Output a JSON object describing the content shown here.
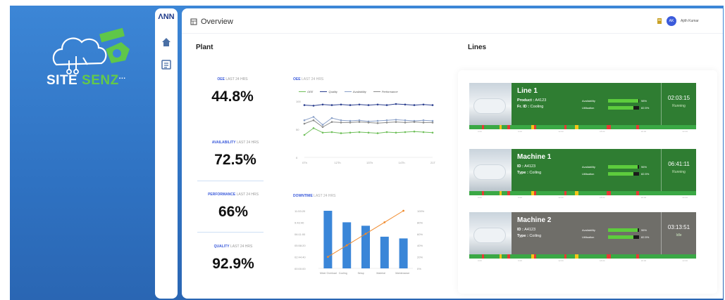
{
  "brand": {
    "name_part1": "SITE ",
    "name_part2": "SENZ",
    "name_suffix": "..."
  },
  "rail": {
    "logo": "ΛNN"
  },
  "header": {
    "title": "Overview",
    "user_initials": "AK",
    "user_name": "Ajith Kumar"
  },
  "plant": {
    "title": "Plant"
  },
  "lines_title": "Lines",
  "kpis": [
    {
      "name": "OEE",
      "period": "LAST 24 HRS",
      "value": "44.8%"
    },
    {
      "name": "AVAILABILITY",
      "period": "LAST 24 HRS",
      "value": "72.5%"
    },
    {
      "name": "PERFORMANCE",
      "period": "LAST 24 HRS",
      "value": "66%"
    },
    {
      "name": "QUALITY",
      "period": "LAST 24 HRS",
      "value": "92.9%"
    }
  ],
  "colors": {
    "accent": "#3b5bdb",
    "running": "#2f7d32",
    "idle": "#6f6e69",
    "bar": "#3a86d8",
    "pareto": "#f08a2c"
  },
  "chart_data": [
    {
      "type": "line",
      "title": "OEE",
      "subtitle": "LAST 24 HRS",
      "x": [
        "0Th",
        "12Th",
        "13Th",
        "14Th",
        "21Th"
      ],
      "ylim": [
        0,
        100
      ],
      "yticks": [
        "100",
        "50",
        "0"
      ],
      "series": [
        {
          "name": "OEE",
          "color": "#6fbf5a",
          "values": [
            40,
            52,
            44,
            45,
            43,
            44,
            45,
            44,
            43,
            45,
            44,
            45,
            46,
            45,
            44
          ]
        },
        {
          "name": "Quality",
          "color": "#2b3f8f",
          "values": [
            93,
            92,
            94,
            93,
            94,
            93,
            94,
            93,
            94,
            93,
            95,
            94,
            93,
            94,
            93
          ]
        },
        {
          "name": "Availability",
          "color": "#8aa0c8",
          "values": [
            66,
            72,
            58,
            70,
            66,
            65,
            66,
            64,
            65,
            66,
            67,
            66,
            65,
            66,
            65
          ]
        },
        {
          "name": "Performance",
          "color": "#8b8b8b",
          "values": [
            60,
            66,
            54,
            63,
            62,
            62,
            63,
            62,
            61,
            62,
            63,
            62,
            63,
            62,
            62
          ]
        }
      ]
    },
    {
      "type": "bar",
      "title": "DOWNTIME",
      "subtitle": "LAST 24 HRS",
      "categories": [
        "Mixer Overload",
        "Cooling",
        "Setup",
        "Material",
        "Maintenance"
      ],
      "values": [
        100,
        80,
        74,
        55,
        52
      ],
      "yticks_left": [
        "11:53:20",
        "9:43:40",
        "06:11:00",
        "05:58:20",
        "02:44:40",
        "00:00:00"
      ],
      "yticks_right": [
        "100%",
        "80%",
        "60%",
        "40%",
        "20%",
        "0%"
      ],
      "cumulative_pct": [
        20,
        40,
        60,
        80,
        100
      ]
    }
  ],
  "cards": [
    {
      "name": "Line 1",
      "row1_label": "Product :",
      "row1_value": "A4123",
      "row2_label": "Fr. ID :",
      "row2_value": "Cooling",
      "availability_label": "Availability",
      "availability": 0.98,
      "availability_text": "98%",
      "utilisation_label": "Utilisation",
      "utilisation": 0.825,
      "utilisation_text": "82.5%",
      "time": "02:03:15",
      "status": "Running",
      "state": "running",
      "ticks": [
        "0:00",
        "6:00",
        "12:00",
        "18:00",
        "20:00",
        "22:00"
      ]
    },
    {
      "name": "Machine 1",
      "row1_label": "ID :",
      "row1_value": "A4123",
      "row2_label": "Type :",
      "row2_value": "Coiling",
      "availability_label": "Availability",
      "availability": 0.96,
      "availability_text": "96%",
      "utilisation_label": "Utilisation",
      "utilisation": 0.825,
      "utilisation_text": "82.5%",
      "time": "06:41:11",
      "status": "Running",
      "state": "running",
      "ticks": [
        "0:00",
        "6:00",
        "12:00",
        "18:00",
        "20:00",
        "22:00"
      ]
    },
    {
      "name": "Machine 2",
      "row1_label": "ID :",
      "row1_value": "A4123",
      "row2_label": "Type :",
      "row2_value": "Coiling",
      "availability_label": "Availability",
      "availability": 0.96,
      "availability_text": "96%",
      "utilisation_label": "Utilisation",
      "utilisation": 0.825,
      "utilisation_text": "82.5%",
      "time": "03:13:51",
      "status": "Idle",
      "state": "idle",
      "ticks": [
        "0:00",
        "6:00",
        "12:00",
        "18:00",
        "20:00",
        "22:00"
      ]
    }
  ]
}
